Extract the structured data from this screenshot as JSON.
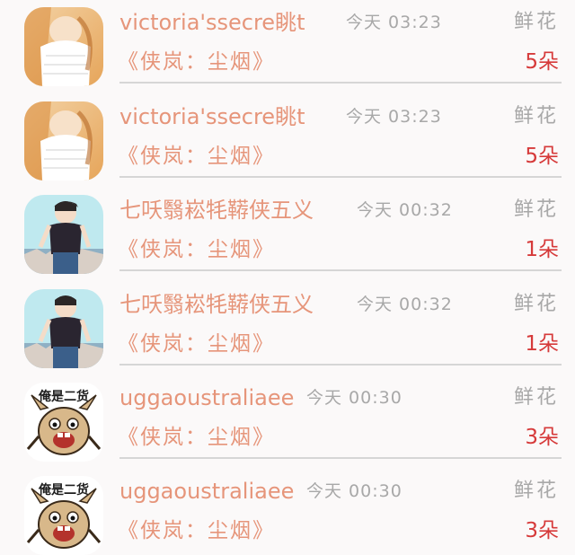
{
  "rows": [
    {
      "name": "victoria'ssecre眺t",
      "time": "今天 03:23",
      "gift": "鲜花",
      "work": "《侠岚：尘烟》",
      "count": "5朵",
      "avatar": "girl-white-top-avatar"
    },
    {
      "name": "victoria'ssecre眺t",
      "time": "今天 03:23",
      "gift": "鲜花",
      "work": "《侠岚：尘烟》",
      "count": "5朵",
      "avatar": "girl-white-top-avatar"
    },
    {
      "name": "七㕭翳崧牦鞯侠五义",
      "time": "今天 00:32",
      "gift": "鲜花",
      "work": "《侠岚：尘烟》",
      "count": "1朵",
      "avatar": "anime-boy-avatar"
    },
    {
      "name": "七㕭翳崧牦鞯侠五义",
      "time": "今天 00:32",
      "gift": "鲜花",
      "work": "《侠岚：尘烟》",
      "count": "1朵",
      "avatar": "anime-boy-avatar"
    },
    {
      "name": "uggaoustraliaee",
      "time": "今天 00:30",
      "gift": "鲜花",
      "work": "《侠岚：尘烟》",
      "count": "3朵",
      "avatar": "cartoon-rabbit-avatar",
      "avatar_text": "俺是二货"
    },
    {
      "name": "uggaoustraliaee",
      "time": "今天 00:30",
      "gift": "鲜花",
      "work": "《侠岚：尘烟》",
      "count": "3朵",
      "avatar": "cartoon-rabbit-avatar",
      "avatar_text": "俺是二货"
    }
  ],
  "colors": {
    "name": "#e6957a",
    "meta": "#a8a8a8",
    "count": "#d63a3a",
    "divider": "#d6d6d6",
    "background": "#fbf9f9"
  }
}
